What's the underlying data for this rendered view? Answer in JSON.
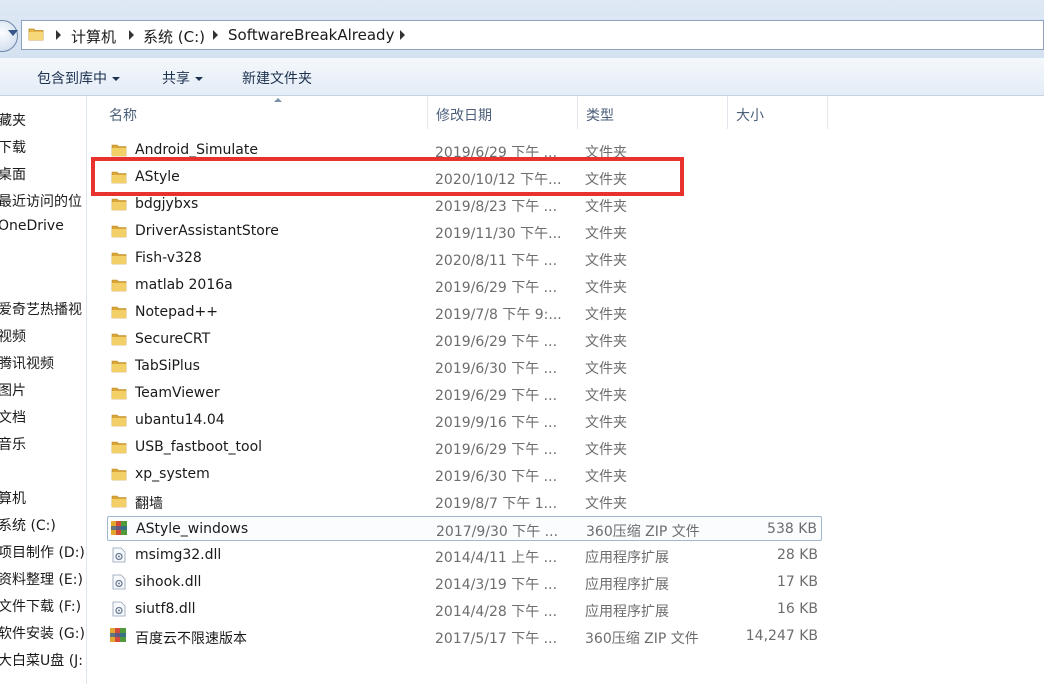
{
  "address": {
    "crumbs": [
      "计算机",
      "系统 (C:)",
      "SoftwareBreakAlready"
    ]
  },
  "toolbar": {
    "include_library": "包含到库中",
    "share": "共享",
    "new_folder": "新建文件夹"
  },
  "nav": {
    "items": [
      "藏夹",
      "下载",
      "桌面",
      "最近访问的位",
      "OneDrive",
      "爱奇艺热播视",
      "视频",
      "腾讯视频",
      "图片",
      "文档",
      "音乐",
      "算机",
      "系统 (C:)",
      "项目制作 (D:)",
      "资料整理 (E:)",
      "文件下载 (F:)",
      "软件安装 (G:)",
      "大白菜U盘 (J:"
    ]
  },
  "columns": {
    "name": "名称",
    "date": "修改日期",
    "type": "类型",
    "size": "大小"
  },
  "files": [
    {
      "name": "Android_Simulate",
      "date": "2019/6/29 下午 ...",
      "type": "文件夹",
      "size": "",
      "icon": "folder-icon"
    },
    {
      "name": "AStyle",
      "date": "2020/10/12 下午...",
      "type": "文件夹",
      "size": "",
      "icon": "folder-icon"
    },
    {
      "name": "bdgjybxs",
      "date": "2019/8/23 下午 ...",
      "type": "文件夹",
      "size": "",
      "icon": "folder-icon"
    },
    {
      "name": "DriverAssistantStore",
      "date": "2019/11/30 下午...",
      "type": "文件夹",
      "size": "",
      "icon": "folder-icon"
    },
    {
      "name": "Fish-v328",
      "date": "2020/8/11 下午 ...",
      "type": "文件夹",
      "size": "",
      "icon": "folder-icon"
    },
    {
      "name": "matlab 2016a",
      "date": "2019/6/29 下午 ...",
      "type": "文件夹",
      "size": "",
      "icon": "folder-icon"
    },
    {
      "name": "Notepad++",
      "date": "2019/7/8 下午 9:...",
      "type": "文件夹",
      "size": "",
      "icon": "folder-icon"
    },
    {
      "name": "SecureCRT",
      "date": "2019/6/29 下午 ...",
      "type": "文件夹",
      "size": "",
      "icon": "folder-icon"
    },
    {
      "name": "TabSiPlus",
      "date": "2019/6/30 下午 ...",
      "type": "文件夹",
      "size": "",
      "icon": "folder-icon"
    },
    {
      "name": "TeamViewer",
      "date": "2019/6/29 下午 ...",
      "type": "文件夹",
      "size": "",
      "icon": "folder-icon"
    },
    {
      "name": "ubantu14.04",
      "date": "2019/9/16 下午 ...",
      "type": "文件夹",
      "size": "",
      "icon": "folder-icon"
    },
    {
      "name": "USB_fastboot_tool",
      "date": "2019/6/29 下午 ...",
      "type": "文件夹",
      "size": "",
      "icon": "folder-icon"
    },
    {
      "name": "xp_system",
      "date": "2019/6/30 下午 ...",
      "type": "文件夹",
      "size": "",
      "icon": "folder-icon"
    },
    {
      "name": "翻墙",
      "date": "2019/8/7 下午 1...",
      "type": "文件夹",
      "size": "",
      "icon": "folder-icon"
    },
    {
      "name": "AStyle_windows",
      "date": "2017/9/30 下午 ...",
      "type": "360压缩 ZIP 文件",
      "size": "538 KB",
      "icon": "zip-archive-icon"
    },
    {
      "name": "msimg32.dll",
      "date": "2014/4/11 上午 ...",
      "type": "应用程序扩展",
      "size": "28 KB",
      "icon": "dll-file-icon"
    },
    {
      "name": "sihook.dll",
      "date": "2014/3/19 下午 ...",
      "type": "应用程序扩展",
      "size": "17 KB",
      "icon": "dll-file-icon"
    },
    {
      "name": "siutf8.dll",
      "date": "2014/4/28 下午 ...",
      "type": "应用程序扩展",
      "size": "16 KB",
      "icon": "dll-file-icon"
    },
    {
      "name": "百度云不限速版本",
      "date": "2017/5/17 下午 ...",
      "type": "360压缩 ZIP 文件",
      "size": "14,247 KB",
      "icon": "zip-archive-icon"
    }
  ],
  "selected_row": "AStyle_windows",
  "highlighted_row": "AStyle",
  "colors": {
    "highlight": "#e8322e",
    "folder": "#f2c55c"
  }
}
